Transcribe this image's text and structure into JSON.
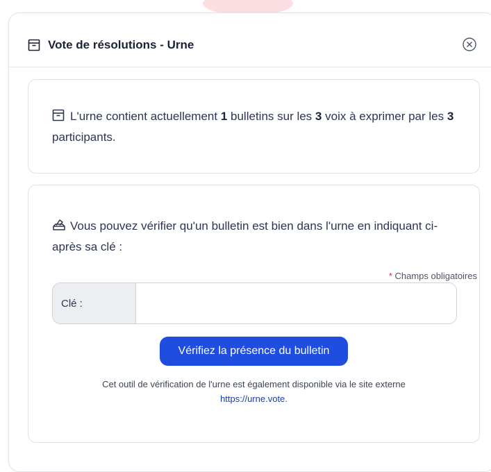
{
  "modal": {
    "title": "Vote de résolutions - Urne",
    "title_icon": "archive-box-icon",
    "close_icon": "close-circle-icon"
  },
  "urn_status": {
    "icon": "archive-box-icon",
    "text_1": "L'urne contient actuellement ",
    "ballots": "1",
    "text_2": " bulletins sur les ",
    "votes": "3",
    "text_3": " voix à exprimer par les ",
    "participants": "3",
    "text_4": " participants."
  },
  "verify": {
    "icon": "ballot-box-icon",
    "intro": "Vous pouvez vérifier qu'un bulletin est bien dans l'urne en indiquant ci-après sa clé :",
    "required_star": "*",
    "required_note": " Champs obligatoires",
    "key_label": "Clé :",
    "key_value": "",
    "button_label": "Vérifiez la présence du bulletin",
    "footnote_text": "Cet outil de vérification de l'urne est également disponible via le site externe",
    "footnote_link": "https://urne.vote",
    "footnote_end": "."
  },
  "colors": {
    "primary": "#1e4de0",
    "required": "#d9304a",
    "border": "#dfe2e7",
    "label_bg": "#eceef1"
  }
}
